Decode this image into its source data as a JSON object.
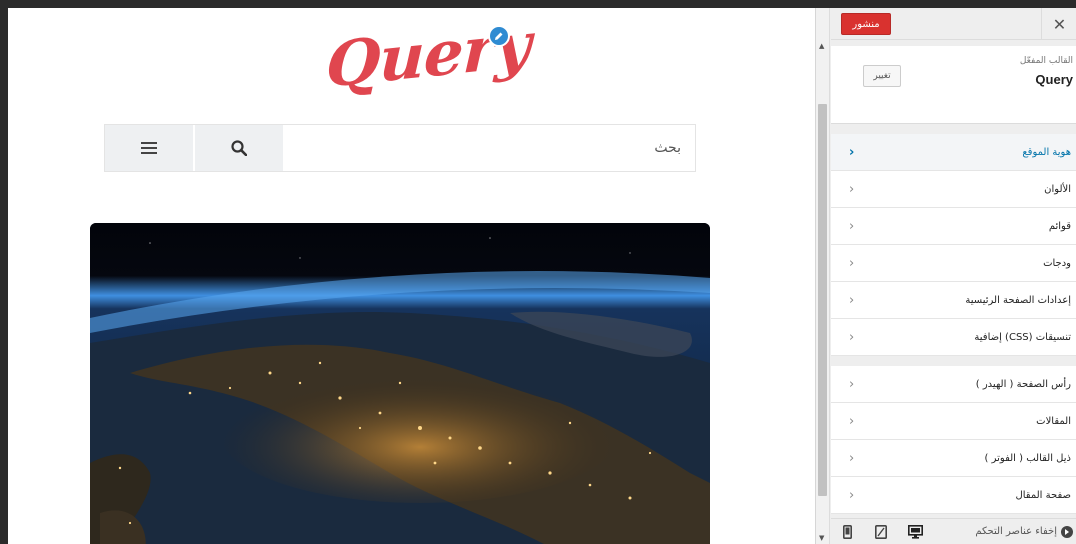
{
  "site": {
    "logo_text": "Query",
    "search": {
      "placeholder": "بحث"
    }
  },
  "customizer": {
    "publish_label": "منشور",
    "close_label": "✕",
    "theme_caption": "القالب المفعّل",
    "theme_name": "Query",
    "change_label": "تغيير",
    "sections_primary": [
      {
        "label": "هوية الموقع",
        "active": true
      },
      {
        "label": "الألوان"
      },
      {
        "label": "قوائم"
      },
      {
        "label": "ودجات"
      },
      {
        "label": "إعدادات الصفحة الرئيسية"
      },
      {
        "label": "تنسيقات (CSS) إضافية"
      }
    ],
    "sections_secondary": [
      {
        "label": "رأس الصفحة ( الهيدر )"
      },
      {
        "label": "المقالات"
      },
      {
        "label": "ذيل القالب ( الفوتر )"
      },
      {
        "label": "صفحة المقال"
      }
    ],
    "footer": {
      "hide_controls_label": "إخفاء عناصر التحكم"
    }
  },
  "colors": {
    "accent": "#0073aa",
    "publish": "#d9322f",
    "logo": "#e0464f"
  }
}
